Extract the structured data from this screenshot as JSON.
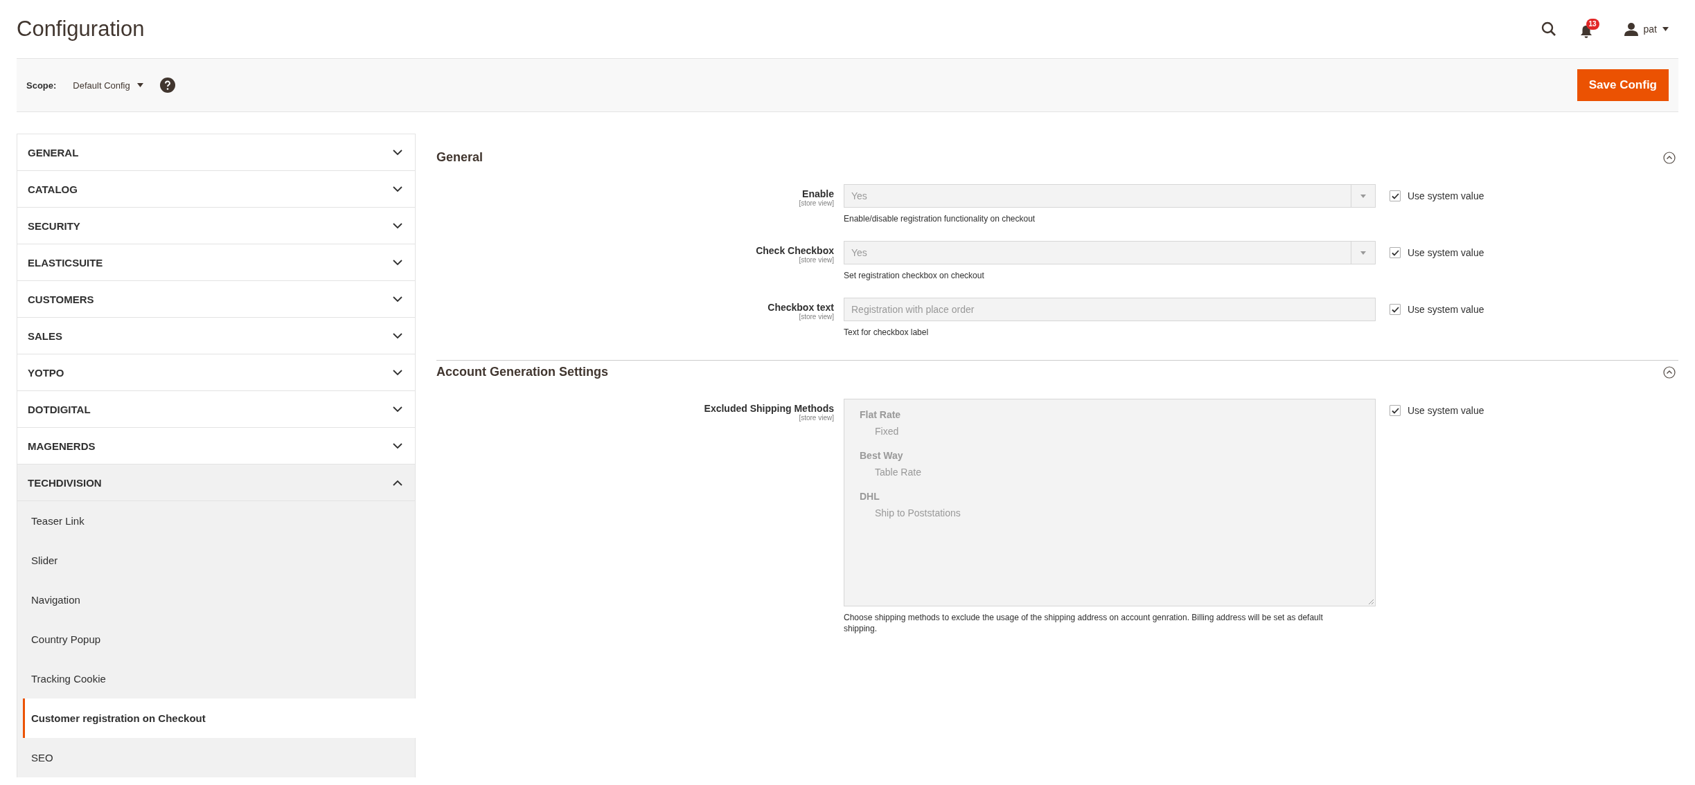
{
  "header": {
    "title": "Configuration",
    "notifications_count": "13",
    "user": "pat"
  },
  "scope_bar": {
    "label": "Scope:",
    "value": "Default Config",
    "save_button": "Save Config"
  },
  "sidebar": {
    "sections": [
      {
        "label": "GENERAL",
        "expanded": false
      },
      {
        "label": "CATALOG",
        "expanded": false
      },
      {
        "label": "SECURITY",
        "expanded": false
      },
      {
        "label": "ELASTICSUITE",
        "expanded": false
      },
      {
        "label": "CUSTOMERS",
        "expanded": false
      },
      {
        "label": "SALES",
        "expanded": false
      },
      {
        "label": "YOTPO",
        "expanded": false
      },
      {
        "label": "DOTDIGITAL",
        "expanded": false
      },
      {
        "label": "MAGENERDS",
        "expanded": false
      },
      {
        "label": "TECHDIVISION",
        "expanded": true,
        "children": [
          {
            "label": "Teaser Link",
            "selected": false
          },
          {
            "label": "Slider",
            "selected": false
          },
          {
            "label": "Navigation",
            "selected": false
          },
          {
            "label": "Country Popup",
            "selected": false
          },
          {
            "label": "Tracking Cookie",
            "selected": false
          },
          {
            "label": "Customer registration on Checkout",
            "selected": true
          },
          {
            "label": "SEO",
            "selected": false
          }
        ]
      }
    ]
  },
  "fieldsets": [
    {
      "title": "General",
      "expanded": true,
      "fields": [
        {
          "kind": "select",
          "label": "Enable",
          "scope": "[store view]",
          "value": "Yes",
          "disabled": true,
          "comment": "Enable/disable registration functionality on checkout",
          "use_system_value": {
            "label": "Use system value",
            "checked": true
          }
        },
        {
          "kind": "select",
          "label": "Check Checkbox",
          "scope": "[store view]",
          "value": "Yes",
          "disabled": true,
          "comment": "Set registration checkbox on checkout",
          "use_system_value": {
            "label": "Use system value",
            "checked": true
          }
        },
        {
          "kind": "text",
          "label": "Checkbox text",
          "scope": "[store view]",
          "value": "Registration with place order",
          "disabled": true,
          "comment": "Text for checkbox label",
          "use_system_value": {
            "label": "Use system value",
            "checked": true
          }
        }
      ]
    },
    {
      "title": "Account Generation Settings",
      "expanded": true,
      "fields": [
        {
          "kind": "multiselect",
          "label": "Excluded Shipping Methods",
          "scope": "[store view]",
          "disabled": true,
          "groups": [
            {
              "label": "Flat Rate",
              "options": [
                "Fixed"
              ]
            },
            {
              "label": "Best Way",
              "options": [
                "Table Rate"
              ]
            },
            {
              "label": "DHL",
              "options": [
                "Ship to Poststations"
              ]
            }
          ],
          "comment": "Choose shipping methods to exclude the usage of the shipping address on account genration. Billing address will be set as default shipping.",
          "use_system_value": {
            "label": "Use system value",
            "checked": true
          }
        }
      ]
    }
  ]
}
